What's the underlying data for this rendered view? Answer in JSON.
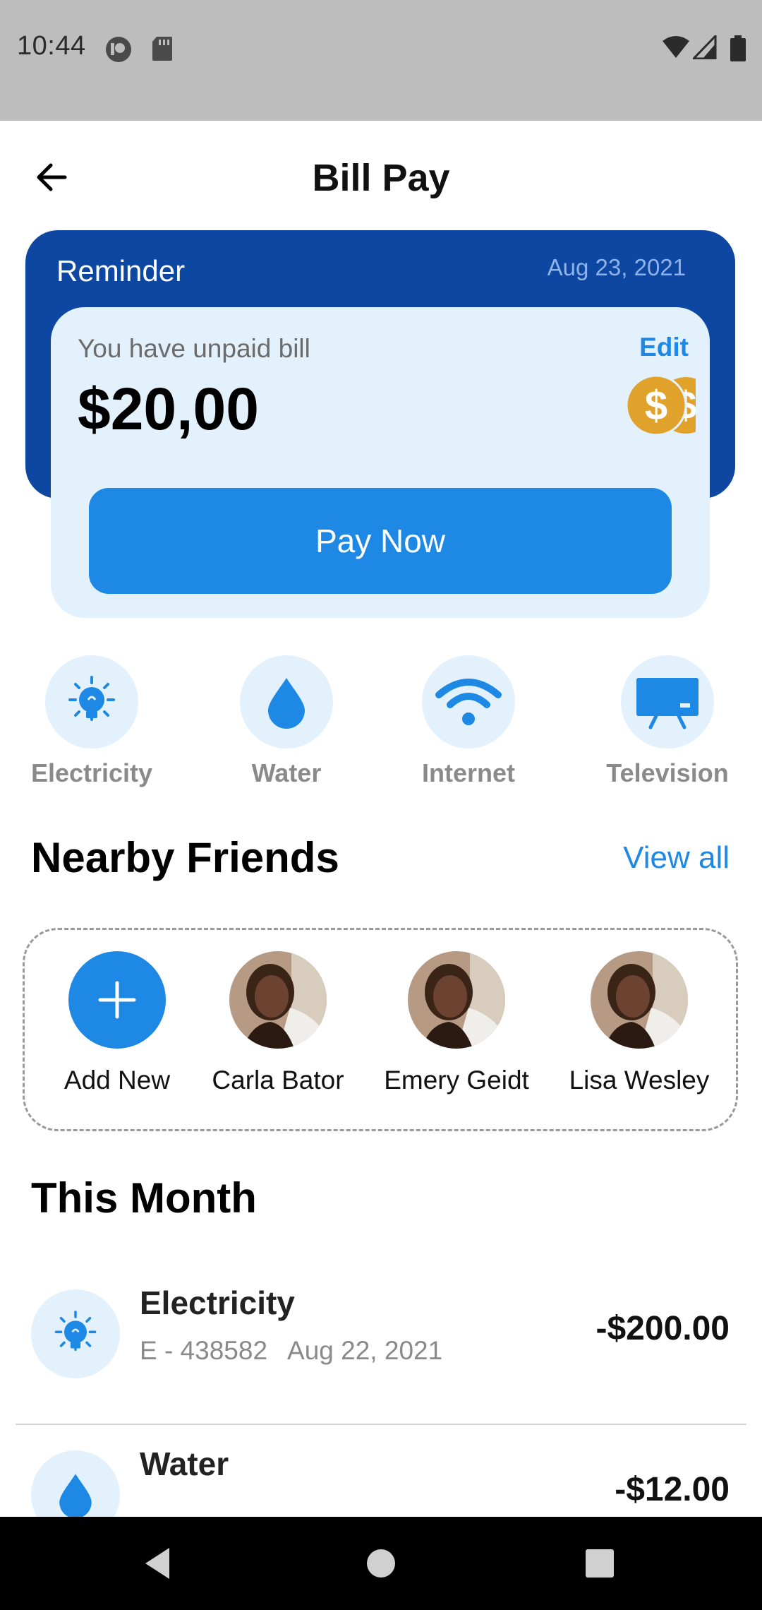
{
  "status_bar": {
    "time": "10:44"
  },
  "header": {
    "title": "Bill Pay"
  },
  "reminder": {
    "label": "Reminder",
    "date": "Aug 23, 2021",
    "unpaid_text": "You have unpaid bill",
    "edit_label": "Edit",
    "amount": "$20,00",
    "pay_button": "Pay Now"
  },
  "categories": [
    {
      "label": "Electricity",
      "icon": "bulb-icon"
    },
    {
      "label": "Water",
      "icon": "drop-icon"
    },
    {
      "label": "Internet",
      "icon": "wifi-icon"
    },
    {
      "label": "Television",
      "icon": "tv-icon"
    }
  ],
  "nearby": {
    "title": "Nearby Friends",
    "view_all": "View all",
    "add_label": "Add New",
    "friends": [
      {
        "name": "Carla Bator"
      },
      {
        "name": "Emery Geidt"
      },
      {
        "name": "Lisa Wesley"
      }
    ]
  },
  "this_month": {
    "title": "This Month",
    "transactions": [
      {
        "title": "Electricity",
        "code": "E - 438582",
        "date": "Aug 22, 2021",
        "amount": "-$200.00"
      },
      {
        "title": "Water",
        "code": "",
        "date": "",
        "amount": "-$12.00"
      }
    ]
  },
  "colors": {
    "primary": "#1e88e5",
    "dark_blue": "#0d47a1",
    "light_blue": "#e3f1fd",
    "coin": "#e0a22a"
  }
}
